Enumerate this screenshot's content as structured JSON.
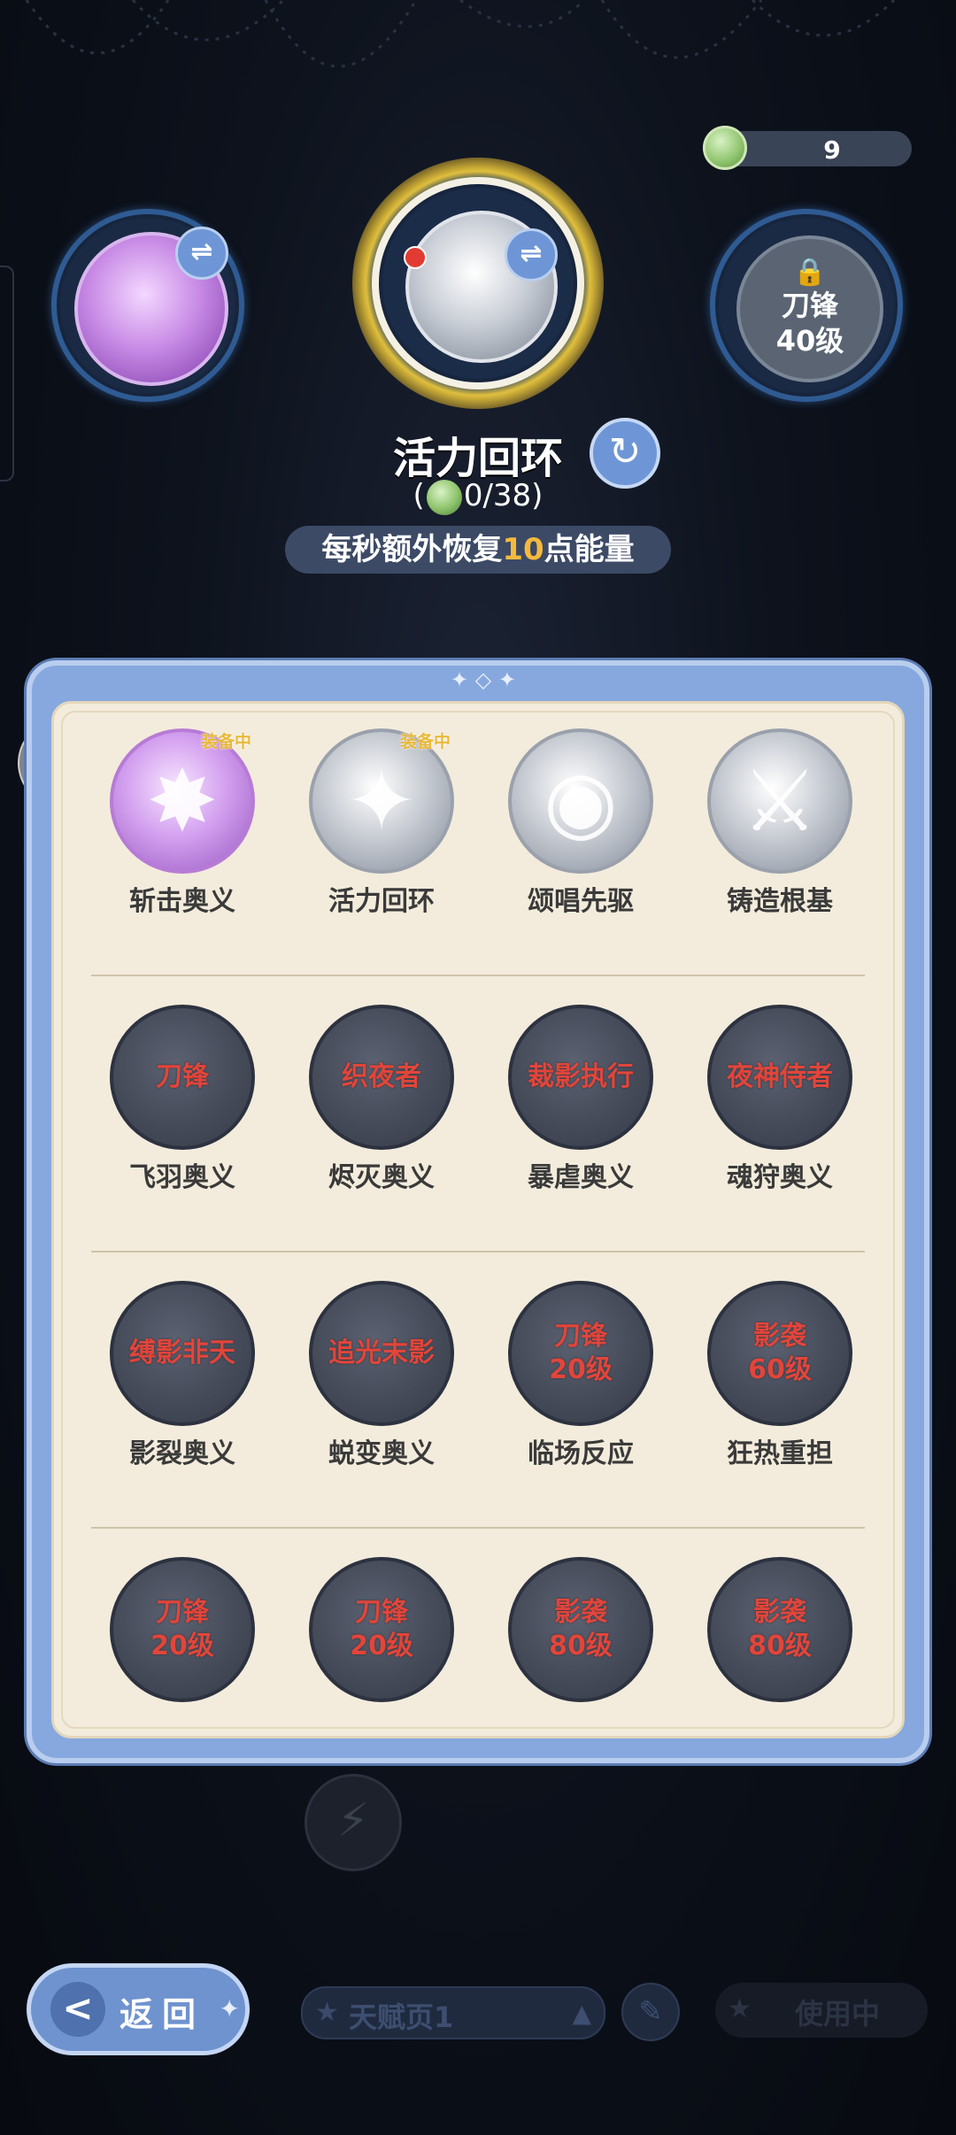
{
  "currency": {
    "amount": "9",
    "icon": "gem-icon"
  },
  "top_slots": {
    "left": {
      "icon": "shattered-crystal-purple-icon",
      "swap_icon": "⇌"
    },
    "center": {
      "icon": "compass-star-silver-icon",
      "swap_icon": "⇌"
    },
    "right": {
      "lock_icon": "🔒",
      "line1": "刀锋",
      "line2": "40级"
    }
  },
  "selected_skill": {
    "title": "活力回环",
    "cost_prefix": "(",
    "cost_text": "0/38)",
    "desc_before": "每秒额外恢复",
    "desc_highlight": "10",
    "desc_after": "点能量",
    "refresh_icon": "↻"
  },
  "panel": {
    "top_decoration": "✦ ◇ ✦",
    "rows": [
      {
        "items": [
          {
            "name": "斩击奥义",
            "style": "purple",
            "badge": "装备中",
            "glyph": "✸"
          },
          {
            "name": "活力回环",
            "style": "silver",
            "badge": "装备中",
            "glyph": "✦"
          },
          {
            "name": "颂唱先驱",
            "style": "silver",
            "badge": "",
            "glyph": "◉"
          },
          {
            "name": "铸造根基",
            "style": "silver",
            "badge": "",
            "glyph": "⚔"
          }
        ]
      },
      {
        "items": [
          {
            "name": "飞羽奥义",
            "style": "dark",
            "lock": "刀锋"
          },
          {
            "name": "烬灭奥义",
            "style": "dark",
            "lock": "织夜者"
          },
          {
            "name": "暴虐奥义",
            "style": "dark",
            "lock": "裁影执行"
          },
          {
            "name": "魂狩奥义",
            "style": "dark",
            "lock": "夜神侍者"
          }
        ]
      },
      {
        "items": [
          {
            "name": "影裂奥义",
            "style": "dark",
            "lock": "缚影非天"
          },
          {
            "name": "蜕变奥义",
            "style": "dark",
            "lock": "追光末影"
          },
          {
            "name": "临场反应",
            "style": "dark",
            "lock": "刀锋\n20级"
          },
          {
            "name": "狂热重担",
            "style": "dark",
            "lock": "影袭\n60级"
          }
        ]
      },
      {
        "items": [
          {
            "name": "",
            "style": "dark",
            "lock": "刀锋\n20级"
          },
          {
            "name": "",
            "style": "dark",
            "lock": "刀锋\n20级"
          },
          {
            "name": "",
            "style": "dark",
            "lock": "影袭\n80级"
          },
          {
            "name": "",
            "style": "dark",
            "lock": "影袭\n80级"
          }
        ]
      }
    ]
  },
  "chat_icon": "💬",
  "bolt_icon": "⚡",
  "bottom_bar": {
    "back_label": "返回",
    "back_arrow": "<",
    "back_tail": "✦",
    "page_star": "★",
    "page_label": "天赋页1",
    "page_triangle": "▲",
    "edit_icon": "✎",
    "inuse_star": "★",
    "inuse_label": "使用中"
  },
  "colors": {
    "accent_blue": "#6f93cf",
    "highlight": "#f5b93c",
    "lock_red": "#e2453a",
    "panel_cream": "#f3ecdc"
  }
}
